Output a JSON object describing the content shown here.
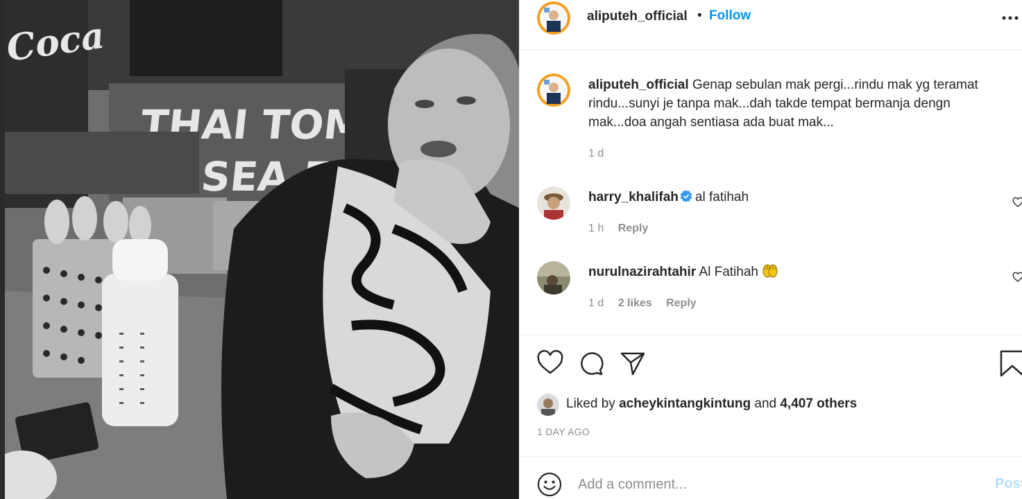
{
  "post": {
    "author": "aliputeh_official",
    "separator": "•",
    "follow_label": "Follow",
    "caption": {
      "user": "aliputeh_official",
      "text": "Genap sebulan mak pergi...rindu mak yg teramat rindu...sunyi je tanpa mak...dah takde tempat bermanja dengn mak...doa angah sentiasa ada buat mak...",
      "time": "1 d"
    },
    "comments": [
      {
        "user": "harry_khalifah",
        "verified": true,
        "text": "al fatihah",
        "time": "1 h",
        "likes": "",
        "reply": "Reply"
      },
      {
        "user": "nurulnazirahtahir",
        "verified": false,
        "text": "Al Fatihah",
        "emoji": "raised-hands-icon",
        "time": "1 d",
        "likes": "2 likes",
        "reply": "Reply"
      }
    ],
    "liked_by": {
      "prefix": "Liked by",
      "user": "acheykintangkintung",
      "and": "and",
      "others": "4,407 others"
    },
    "time_ago": "1 DAY AGO",
    "add_comment_placeholder": "Add a comment...",
    "post_label": "Post"
  },
  "photo": {
    "signs": [
      "Coca",
      "THAI TOM",
      "SEA F"
    ]
  },
  "colors": {
    "link_blue": "#0095f6",
    "post_disabled": "#b2dffc",
    "muted": "#8e8e8e",
    "text": "#262626",
    "verified": "#3897f0"
  }
}
